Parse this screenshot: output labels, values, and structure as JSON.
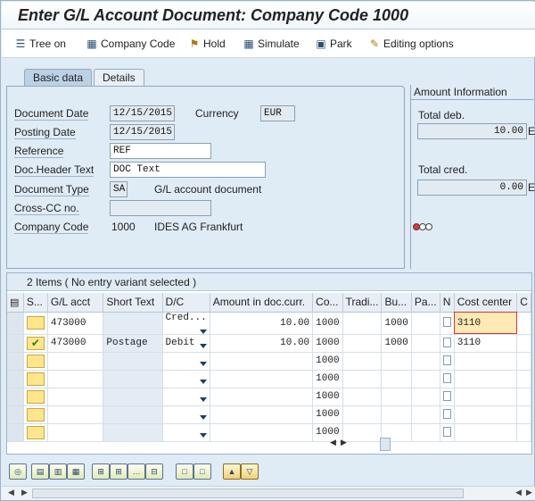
{
  "window": {
    "title": "Enter G/L Account Document: Company Code 1000"
  },
  "toolbar": [
    {
      "label": "Tree on",
      "icon": "tree-icon"
    },
    {
      "label": "Company Code",
      "icon": "company-code-icon"
    },
    {
      "label": "Hold",
      "icon": "hold-icon"
    },
    {
      "label": "Simulate",
      "icon": "simulate-icon"
    },
    {
      "label": "Park",
      "icon": "park-icon"
    },
    {
      "label": "Editing options",
      "icon": "pencil-icon"
    }
  ],
  "tabs": [
    {
      "label": "Basic data",
      "active": true
    },
    {
      "label": "Details",
      "active": false
    }
  ],
  "header": {
    "document_date_label": "Document Date",
    "document_date": "12/15/2015",
    "currency_label": "Currency",
    "currency": "EUR",
    "posting_date_label": "Posting Date",
    "posting_date": "12/15/2015",
    "reference_label": "Reference",
    "reference": "REF",
    "doc_header_text_label": "Doc.Header Text",
    "doc_header_text": "DOC Text",
    "document_type_label": "Document Type",
    "document_type": "SA",
    "document_type_desc": "G/L account document",
    "cross_cc_label": "Cross-CC no.",
    "cross_cc": "",
    "company_code_label": "Company Code",
    "company_code": "1000",
    "company_name": "IDES AG Frankfurt"
  },
  "amount_info": {
    "title": "Amount Information",
    "total_deb_label": "Total deb.",
    "total_deb": "10.00",
    "total_deb_cur": "E",
    "total_cred_label": "Total cred.",
    "total_cred": "0.00",
    "total_cred_cur": "E",
    "status_colors": [
      "#e8332f",
      "#ffffff",
      "#ffffff"
    ]
  },
  "items": {
    "caption": "2 Items ( No entry variant selected )",
    "columns": [
      "S...",
      "G/L acct",
      "Short Text",
      "D/C",
      "Amount in doc.curr.",
      "Co...",
      "Tradi...",
      "Bu...",
      "Pa...",
      "N",
      "Cost center",
      "C"
    ],
    "rows": [
      {
        "gl": "473000",
        "text": "",
        "dc": "Cred...",
        "amount": "10.00",
        "co": "1000",
        "trad": "",
        "bu": "1000",
        "pa": "",
        "cost_center": "3110",
        "checked": false
      },
      {
        "gl": "473000",
        "text": "Postage",
        "dc": "Debit",
        "amount": "10.00",
        "co": "1000",
        "trad": "",
        "bu": "1000",
        "pa": "",
        "cost_center": "3110",
        "checked": true
      },
      {
        "gl": "",
        "text": "",
        "dc": "",
        "amount": "",
        "co": "1000",
        "trad": "",
        "bu": "",
        "pa": "",
        "cost_center": "",
        "checked": false
      },
      {
        "gl": "",
        "text": "",
        "dc": "",
        "amount": "",
        "co": "1000",
        "trad": "",
        "bu": "",
        "pa": "",
        "cost_center": "",
        "checked": false
      },
      {
        "gl": "",
        "text": "",
        "dc": "",
        "amount": "",
        "co": "1000",
        "trad": "",
        "bu": "",
        "pa": "",
        "cost_center": "",
        "checked": false
      },
      {
        "gl": "",
        "text": "",
        "dc": "",
        "amount": "",
        "co": "1000",
        "trad": "",
        "bu": "",
        "pa": "",
        "cost_center": "",
        "checked": false
      },
      {
        "gl": "",
        "text": "",
        "dc": "",
        "amount": "",
        "co": "1000",
        "trad": "",
        "bu": "",
        "pa": "",
        "cost_center": "",
        "checked": false
      }
    ]
  },
  "bottom_toolbar_icons": [
    "details-icon",
    "insert-row-icon",
    "copy-row-icon",
    "paste-row-icon",
    "add-row-icon",
    "add-block-icon",
    "more-icon",
    "delete-row-icon",
    "copy-icon",
    "paste-icon",
    "sort-icon",
    "filter-icon"
  ]
}
